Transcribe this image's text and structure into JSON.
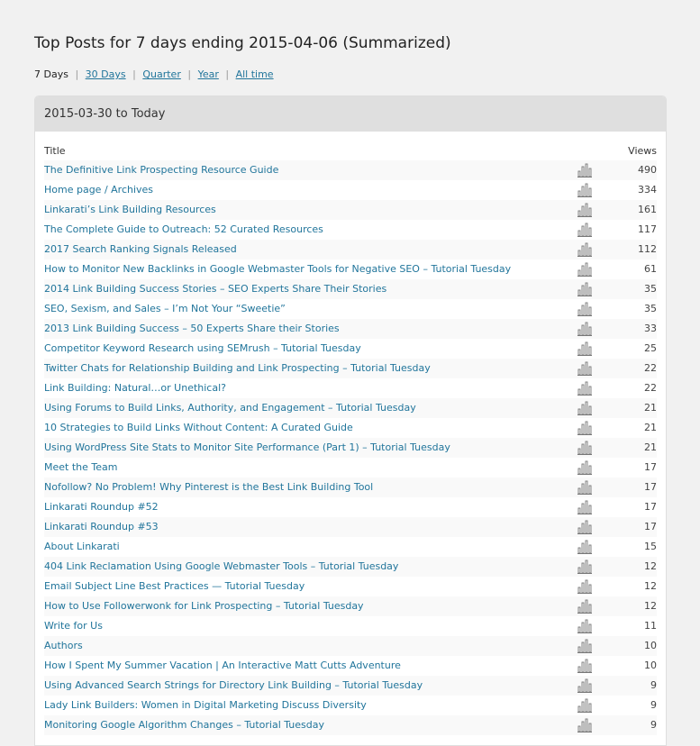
{
  "page": {
    "title": "Top Posts for 7 days ending 2015-04-06 (Summarized)"
  },
  "periods": {
    "current": "7 Days",
    "links": [
      "30 Days",
      "Quarter",
      "Year",
      "All time"
    ]
  },
  "panel": {
    "range_label": "2015-03-30 to Today",
    "col_title": "Title",
    "col_views": "Views"
  },
  "posts": [
    {
      "title": "The Definitive Link Prospecting Resource Guide",
      "views": "490"
    },
    {
      "title": "Home page / Archives",
      "views": "334"
    },
    {
      "title": "Linkarati’s Link Building Resources",
      "views": "161"
    },
    {
      "title": "The Complete Guide to Outreach: 52 Curated Resources",
      "views": "117"
    },
    {
      "title": "2017 Search Ranking Signals Released",
      "views": "112"
    },
    {
      "title": "How to Monitor New Backlinks in Google Webmaster Tools for Negative SEO – Tutorial Tuesday",
      "views": "61"
    },
    {
      "title": "2014 Link Building Success Stories – SEO Experts Share Their Stories",
      "views": "35"
    },
    {
      "title": "SEO, Sexism, and Sales – I’m Not Your “Sweetie”",
      "views": "35"
    },
    {
      "title": "2013 Link Building Success – 50 Experts Share their Stories",
      "views": "33"
    },
    {
      "title": "Competitor Keyword Research using SEMrush – Tutorial Tuesday",
      "views": "25"
    },
    {
      "title": "Twitter Chats for Relationship Building and Link Prospecting – Tutorial Tuesday",
      "views": "22"
    },
    {
      "title": "Link Building: Natural…or Unethical?",
      "views": "22"
    },
    {
      "title": "Using Forums to Build Links, Authority, and Engagement – Tutorial Tuesday",
      "views": "21"
    },
    {
      "title": "10 Strategies to Build Links Without Content: A Curated Guide",
      "views": "21"
    },
    {
      "title": "Using WordPress Site Stats to Monitor Site Performance (Part 1) – Tutorial Tuesday",
      "views": "21"
    },
    {
      "title": "Meet the Team",
      "views": "17"
    },
    {
      "title": "Nofollow? No Problem! Why Pinterest is the Best Link Building Tool",
      "views": "17"
    },
    {
      "title": "Linkarati Roundup #52",
      "views": "17"
    },
    {
      "title": "Linkarati Roundup #53",
      "views": "17"
    },
    {
      "title": "About Linkarati",
      "views": "15"
    },
    {
      "title": "404 Link Reclamation Using Google Webmaster Tools – Tutorial Tuesday",
      "views": "12"
    },
    {
      "title": "Email Subject Line Best Practices — Tutorial Tuesday",
      "views": "12"
    },
    {
      "title": "How to Use Followerwonk for Link Prospecting – Tutorial Tuesday",
      "views": "12"
    },
    {
      "title": "Write for Us",
      "views": "11"
    },
    {
      "title": "Authors",
      "views": "10"
    },
    {
      "title": "How I Spent My Summer Vacation | An Interactive Matt Cutts Adventure",
      "views": "10"
    },
    {
      "title": "Using Advanced Search Strings for Directory Link Building – Tutorial Tuesday",
      "views": "9"
    },
    {
      "title": "Lady Link Builders: Women in Digital Marketing Discuss Diversity",
      "views": "9"
    },
    {
      "title": "Monitoring Google Algorithm Changes – Tutorial Tuesday",
      "views": "9"
    }
  ],
  "icons": {
    "row_chart": "bar-chart-icon"
  },
  "colors": {
    "link": "#21759b",
    "panel_header": "#dfdfdf",
    "row_stripe": "#f9f9f9"
  }
}
